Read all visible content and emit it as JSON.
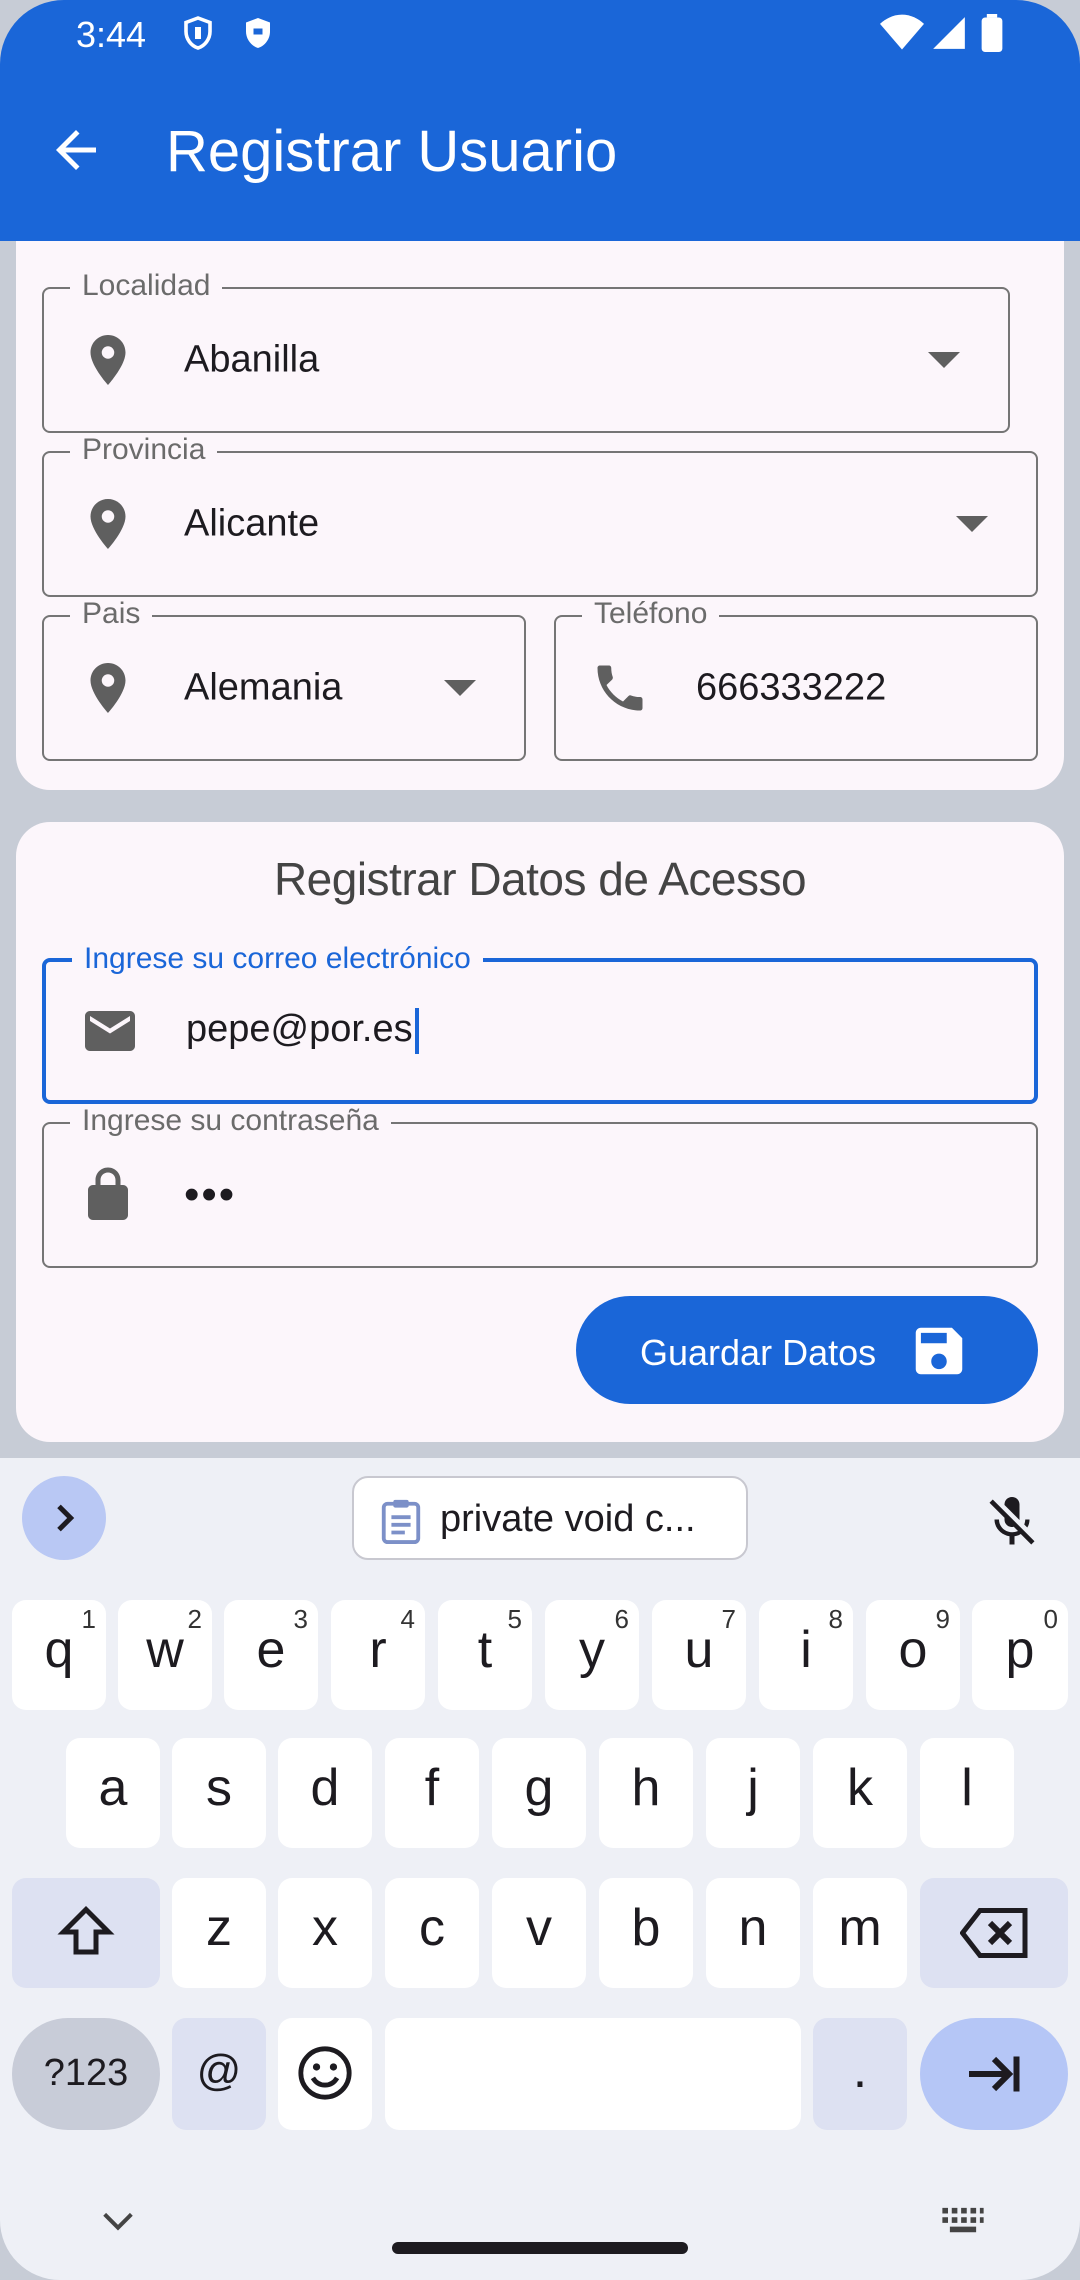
{
  "status_bar": {
    "time": "3:44"
  },
  "app_bar": {
    "title": "Registrar Usuario"
  },
  "address": {
    "localidad": {
      "label": "Localidad",
      "value": "Abanilla"
    },
    "provincia": {
      "label": "Provincia",
      "value": "Alicante"
    },
    "pais": {
      "label": "Pais",
      "value": "Alemania"
    },
    "telefono": {
      "label": "Teléfono",
      "value": "666333222"
    }
  },
  "access": {
    "title": "Registrar Datos de Acesso",
    "email": {
      "label": "Ingrese su correo electrónico",
      "value": "pepe@por.es"
    },
    "password": {
      "label": "Ingrese su contraseña",
      "value": "•••"
    },
    "save_label": "Guardar Datos"
  },
  "keyboard": {
    "suggestion": "private void c...",
    "row1": [
      {
        "k": "q",
        "n": "1"
      },
      {
        "k": "w",
        "n": "2"
      },
      {
        "k": "e",
        "n": "3"
      },
      {
        "k": "r",
        "n": "4"
      },
      {
        "k": "t",
        "n": "5"
      },
      {
        "k": "y",
        "n": "6"
      },
      {
        "k": "u",
        "n": "7"
      },
      {
        "k": "i",
        "n": "8"
      },
      {
        "k": "o",
        "n": "9"
      },
      {
        "k": "p",
        "n": "0"
      }
    ],
    "row2": [
      "a",
      "s",
      "d",
      "f",
      "g",
      "h",
      "j",
      "k",
      "l"
    ],
    "row3": [
      "z",
      "x",
      "c",
      "v",
      "b",
      "n",
      "m"
    ],
    "sym_label": "?123",
    "at_label": "@",
    "dot_label": "."
  },
  "colors": {
    "primary": "#1a66d8",
    "surface": "#fcf6fb",
    "background": "#c7ccd6"
  }
}
